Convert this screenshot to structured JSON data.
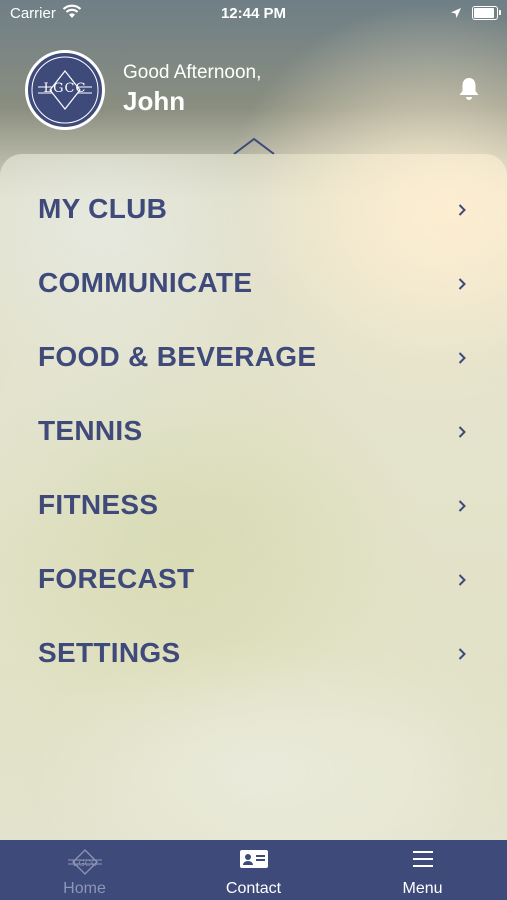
{
  "status_bar": {
    "carrier": "Carrier",
    "time": "12:44 PM",
    "battery_level": 1.0
  },
  "header": {
    "logo_text": "LGCC",
    "greeting": "Good Afternoon,",
    "user_name": "John",
    "bell_icon": "bell-icon"
  },
  "menu": {
    "items": [
      {
        "label": "MY CLUB"
      },
      {
        "label": "COMMUNICATE"
      },
      {
        "label": "FOOD & BEVERAGE"
      },
      {
        "label": "TENNIS"
      },
      {
        "label": "FITNESS"
      },
      {
        "label": "FORECAST"
      },
      {
        "label": "SETTINGS"
      }
    ]
  },
  "tab_bar": {
    "tabs": [
      {
        "label": "Home",
        "icon": "club-logo-icon",
        "selected": true
      },
      {
        "label": "Contact",
        "icon": "contact-card-icon",
        "selected": false
      },
      {
        "label": "Menu",
        "icon": "hamburger-icon",
        "selected": false
      }
    ]
  },
  "colors": {
    "primary": "#3e4a7a",
    "menu_text": "#3f4a7a",
    "inactive_tab_text": "#8e95b6"
  }
}
